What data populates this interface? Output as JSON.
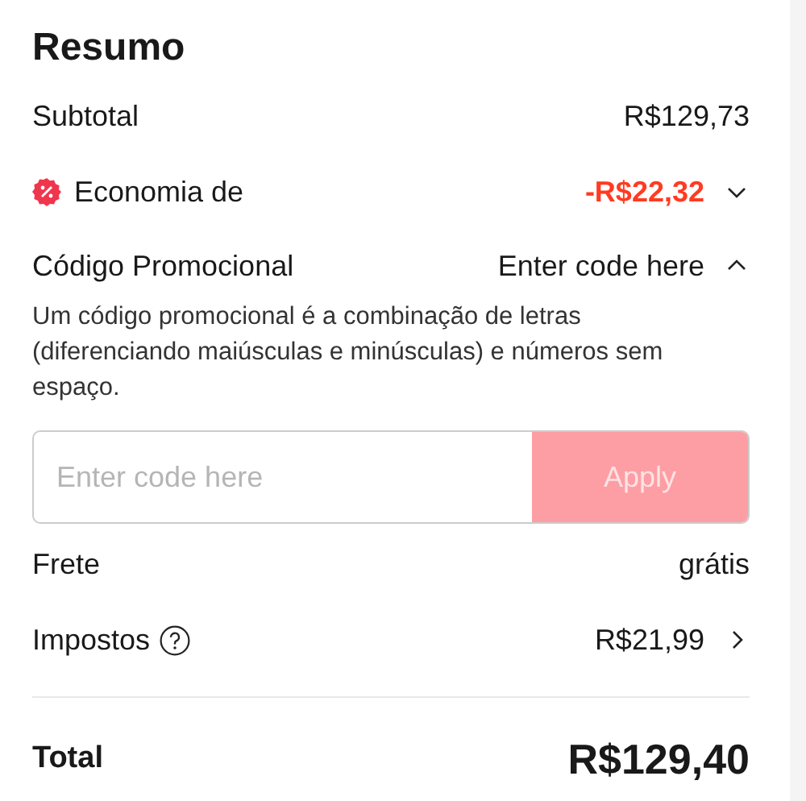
{
  "title": "Resumo",
  "subtotal": {
    "label": "Subtotal",
    "value": "R$129,73"
  },
  "savings": {
    "label": "Economia de",
    "value": "-R$22,32",
    "expanded": false
  },
  "promo": {
    "label": "Código Promocional",
    "value": "Enter code here",
    "expanded": true,
    "description": "Um código promocional é a combinação de letras (diferenciando maiúsculas e minúsculas) e números sem espaço.",
    "placeholder": "Enter code here",
    "apply_button": {
      "label": "Apply",
      "disabled": true
    }
  },
  "shipping": {
    "label": "Frete",
    "value": "grátis"
  },
  "taxes": {
    "label": "Impostos",
    "value": "R$21,99"
  },
  "total": {
    "label": "Total",
    "value": "R$129,40"
  }
}
